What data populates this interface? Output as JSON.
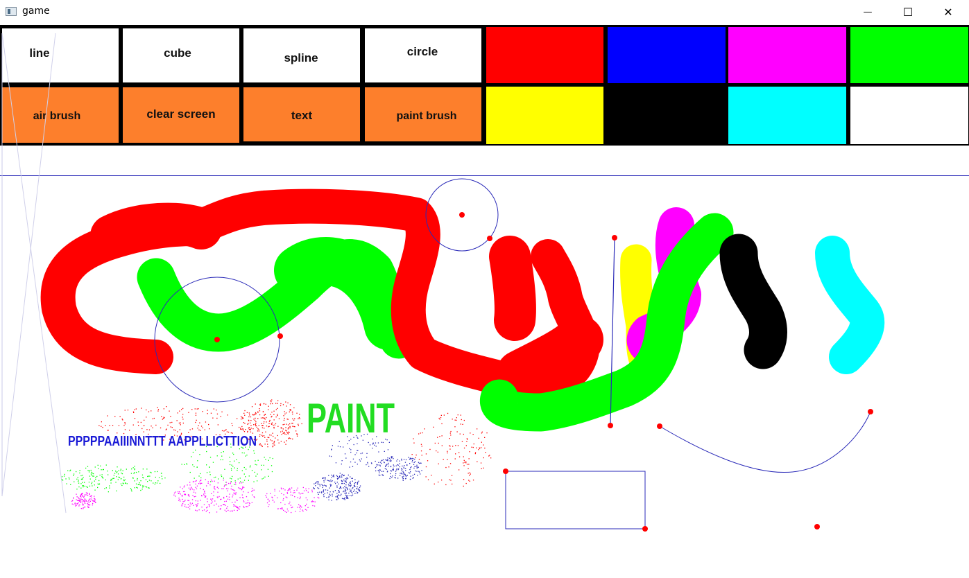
{
  "window": {
    "title": "game",
    "minimize_glyph": "—",
    "maximize_glyph": "☐",
    "close_glyph": "✕"
  },
  "tools": {
    "row1": [
      "line",
      "cube",
      "spline",
      "circle"
    ],
    "row2": [
      "air brush",
      "clear screen",
      "text",
      "paint brush"
    ]
  },
  "palette": {
    "row1": [
      "#ff0000",
      "#0000ff",
      "#ff00ff",
      "#00ff00"
    ],
    "row2": [
      "#ffff00",
      "#000000",
      "#00ffff",
      "#ffffff"
    ]
  },
  "canvas_texts": {
    "small_text": "PPPPPAAIIINNTTT  AAPPLLICTTION",
    "big_text": "PAINT"
  },
  "colors": {
    "tool_white": "#ffffff",
    "tool_orange": "#fd7f2c",
    "line_blue": "#2a2ab8",
    "point_red": "#ff0000",
    "stroke_red": "#ff0000",
    "stroke_green": "#00ff00",
    "stroke_yellow": "#ffff00",
    "stroke_magenta": "#ff00ff",
    "stroke_black": "#000000",
    "stroke_cyan": "#00ffff",
    "small_text": "#1a1ad6",
    "big_text": "#22dd22"
  }
}
